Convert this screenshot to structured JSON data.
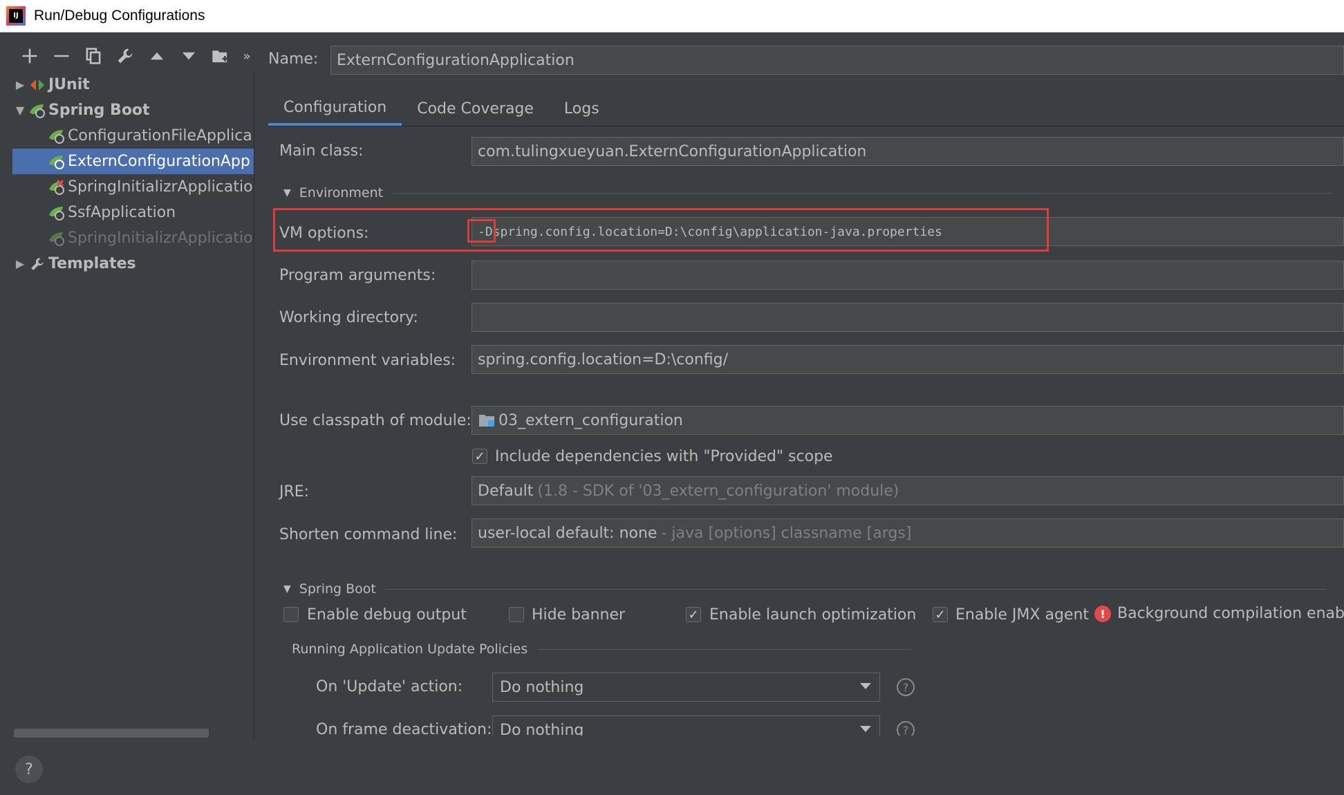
{
  "window": {
    "title": "Run/Debug Configurations"
  },
  "tree": {
    "items": [
      {
        "label": "JUnit"
      },
      {
        "label": "Spring Boot"
      },
      {
        "label": "ConfigurationFileApplica"
      },
      {
        "label": "ExternConfigurationApp"
      },
      {
        "label": "SpringInitializrApplicatio"
      },
      {
        "label": "SsfApplication"
      },
      {
        "label": "SpringInitializrApplicatio"
      },
      {
        "label": "Templates"
      }
    ]
  },
  "name": {
    "label": "Name:",
    "value": "ExternConfigurationApplication"
  },
  "tabs": [
    "Configuration",
    "Code Coverage",
    "Logs"
  ],
  "config": {
    "main_class_label": "Main class:",
    "main_class_value": "com.tulingxueyuan.ExternConfigurationApplication",
    "environment_section": "Environment",
    "vm_options_label": "VM options:",
    "vm_options_value": "-Dspring.config.location=D:\\config\\application-java.properties",
    "program_args_label": "Program arguments:",
    "working_dir_label": "Working directory:",
    "env_vars_label": "Environment variables:",
    "env_vars_value": "spring.config.location=D:\\config/",
    "classpath_label": "Use classpath of module:",
    "classpath_value": "03_extern_configuration",
    "include_deps_label": "Include dependencies with \"Provided\" scope",
    "jre_label": "JRE:",
    "jre_value": "Default",
    "jre_sub": "(1.8 - SDK of '03_extern_configuration' module)",
    "shorten_label": "Shorten command line:",
    "shorten_value": "user-local default: none",
    "shorten_sub": "- java [options] classname [args]"
  },
  "spring_boot": {
    "section": "Spring Boot",
    "enable_debug": "Enable debug output",
    "hide_banner": "Hide banner",
    "enable_launch": "Enable launch optimization",
    "enable_jmx": "Enable JMX agent",
    "background_compilation": "Background compilation enabled",
    "update_policies": "Running Application Update Policies",
    "on_update_label": "On 'Update' action:",
    "on_update_value": "Do nothing",
    "on_frame_label": "On frame deactivation:",
    "on_frame_value": "Do nothing"
  },
  "help": "?"
}
